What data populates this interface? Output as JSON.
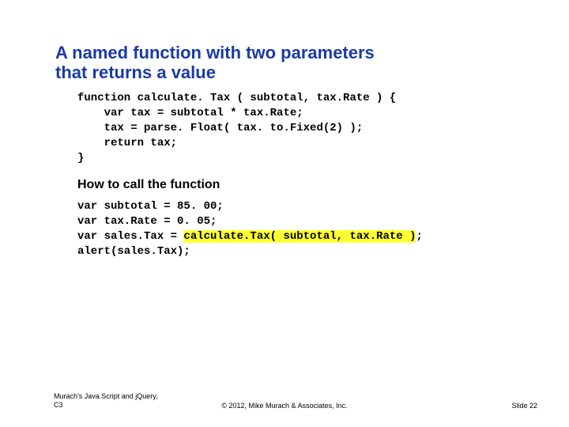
{
  "title_line1": "A named function with two parameters",
  "title_line2": "that returns a value",
  "code1_l1": "function calculate. Tax ( subtotal, tax.Rate ) {",
  "code1_l2": "    var tax = subtotal * tax.Rate;",
  "code1_l3": "    tax = parse. Float( tax. to.Fixed(2) );",
  "code1_l4": "    return tax;",
  "code1_l5": "}",
  "subhead": "How to call the function",
  "code2_l1": "var subtotal = 85. 00;",
  "code2_l2": "var tax.Rate = 0. 05;",
  "code2_l3_a": "var sales.Tax = ",
  "code2_l3_hl": "calculate.Tax( subtotal, tax.Rate )",
  "code2_l3_b": ";",
  "code2_l4": "alert(sales.Tax);",
  "footer_left_l1": "Murach's Java.Script and jQuery,",
  "footer_left_l2": "C3",
  "footer_center": "© 2012, Mike Murach & Associates, Inc.",
  "footer_right": "Slide 22"
}
